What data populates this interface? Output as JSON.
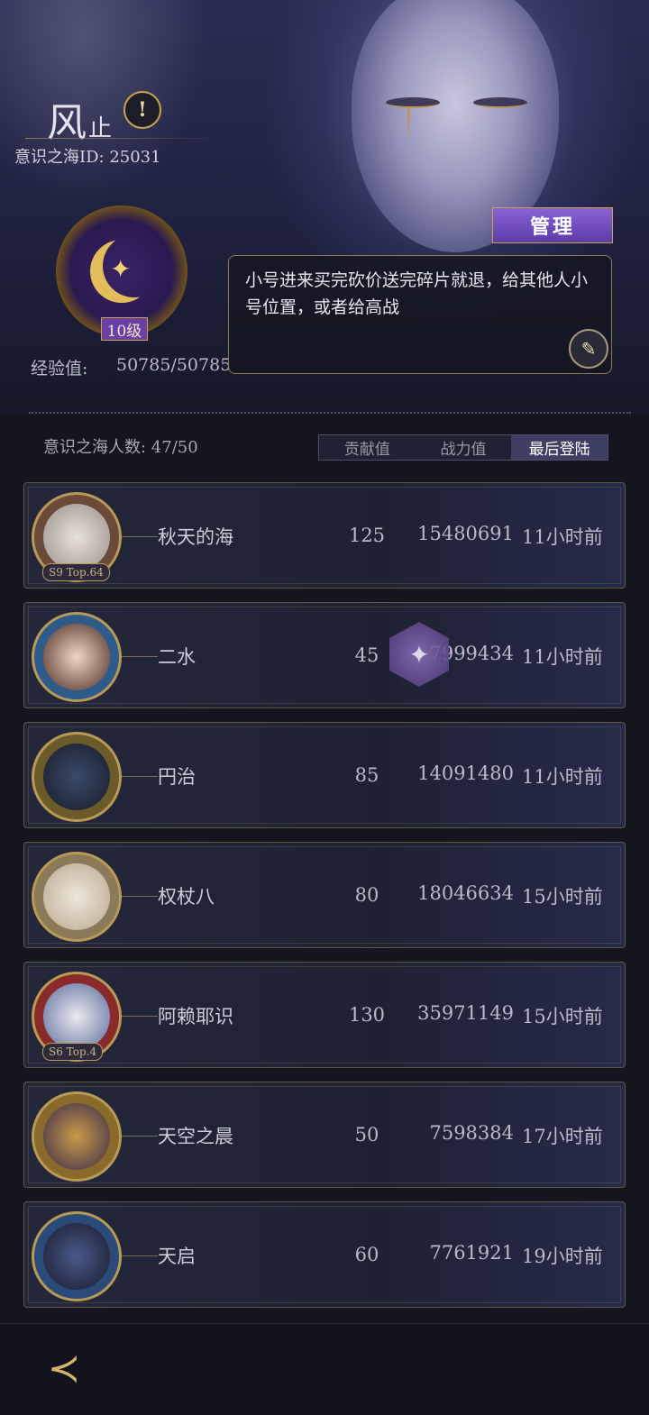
{
  "header": {
    "guild_name_main": "风",
    "guild_name_sub": "止",
    "guild_id": "意识之海ID: 25031",
    "alert_icon": "!",
    "level": "10级",
    "exp_label": "经验值:",
    "exp_value": "50785/50785",
    "manage_label": "管理",
    "notice": "小号进来买完砍价送完碎片就退，给其他人小号位置，或者给高战",
    "edit_icon": "feather-pen"
  },
  "members_header": {
    "count_label": "意识之海人数: 47/50",
    "tabs": [
      {
        "label": "贡献值",
        "active": false
      },
      {
        "label": "战力值",
        "active": false
      },
      {
        "label": "最后登陆",
        "active": true
      }
    ]
  },
  "members": [
    {
      "name": "秋天的海",
      "contribution": "125",
      "power": "15480691",
      "last_login": "11小时前",
      "badge": "S9 Top.64"
    },
    {
      "name": "二水",
      "contribution": "45",
      "power": "7999434",
      "last_login": "11小时前",
      "badge": ""
    },
    {
      "name": "円治",
      "contribution": "85",
      "power": "14091480",
      "last_login": "11小时前",
      "badge": ""
    },
    {
      "name": "权杖八",
      "contribution": "80",
      "power": "18046634",
      "last_login": "15小时前",
      "badge": ""
    },
    {
      "name": "阿赖耶识",
      "contribution": "130",
      "power": "35971149",
      "last_login": "15小时前",
      "badge": "S6 Top.4"
    },
    {
      "name": "天空之晨",
      "contribution": "50",
      "power": "7598384",
      "last_login": "17小时前",
      "badge": ""
    },
    {
      "name": "天启",
      "contribution": "60",
      "power": "7761921",
      "last_login": "19小时前",
      "badge": ""
    }
  ],
  "colors": {
    "accent_gold": "#c9a24c",
    "manage_purple": "#7a52c8",
    "background": "#14151f"
  },
  "footer": {
    "back_icon": "back-arrow-icon"
  }
}
